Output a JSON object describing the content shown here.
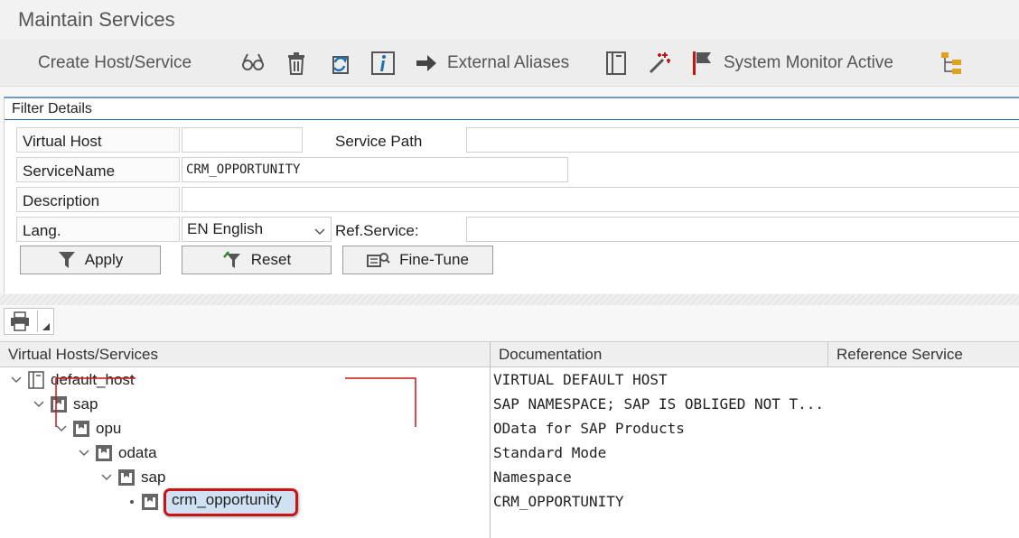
{
  "app": {
    "title": "Maintain Services"
  },
  "toolbar": {
    "create_label": "Create Host/Service",
    "external_aliases_label": "External Aliases",
    "system_monitor_label": "System Monitor Active",
    "icons": [
      "glasses-icon",
      "trash-icon",
      "refresh-icon",
      "info-icon",
      "arrow-right-icon",
      "notebook-icon",
      "magic-wand-icon",
      "flag-icon",
      "hierarchy-icon"
    ]
  },
  "filter": {
    "title": "Filter Details",
    "virtual_host_label": "Virtual Host",
    "virtual_host_value": "",
    "service_path_label": "Service Path",
    "service_path_value": "",
    "service_name_label": "ServiceName",
    "service_name_value": "CRM_OPPORTUNITY",
    "description_label": "Description",
    "description_value": "",
    "lang_label": "Lang.",
    "lang_value": "EN English",
    "ref_service_label": "Ref.Service:",
    "ref_service_value": "",
    "apply_label": "Apply",
    "reset_label": "Reset",
    "finetune_label": "Fine-Tune"
  },
  "grid": {
    "columns": [
      "Virtual Hosts/Services",
      "Documentation",
      "Reference Service"
    ],
    "rows": [
      {
        "name": "default_host",
        "doc": "VIRTUAL DEFAULT HOST",
        "level": 0,
        "expanded": true
      },
      {
        "name": "sap",
        "doc": "SAP NAMESPACE; SAP IS OBLIGED NOT T...",
        "level": 1,
        "expanded": true
      },
      {
        "name": "opu",
        "doc": "OData for SAP Products",
        "level": 2,
        "expanded": true
      },
      {
        "name": "odata",
        "doc": "Standard Mode",
        "level": 3,
        "expanded": true
      },
      {
        "name": "sap",
        "doc": "Namespace",
        "level": 4,
        "expanded": true
      },
      {
        "name": "crm_opportunity",
        "doc": "CRM_OPPORTUNITY",
        "level": 5,
        "expanded": false,
        "selected": true
      }
    ]
  },
  "colors": {
    "accent": "#2f5f8f",
    "highlight": "#c71515",
    "selection": "#cfe1f3"
  }
}
